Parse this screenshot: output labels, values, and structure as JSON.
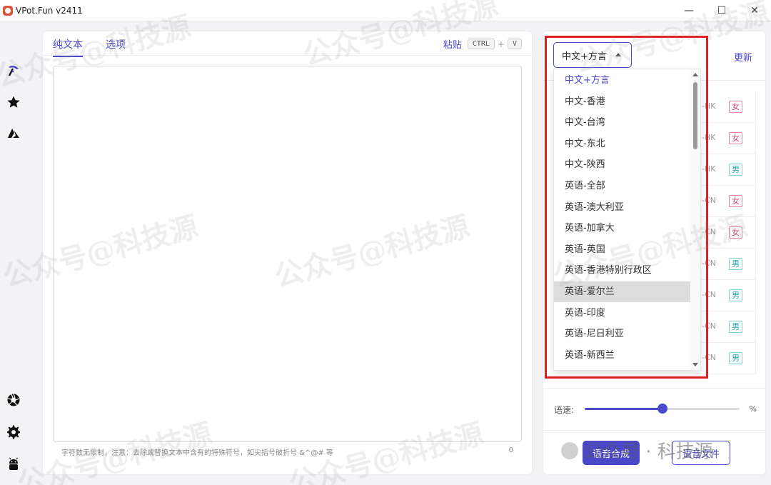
{
  "window": {
    "title": "VPot.Fun v2411",
    "controls": [
      "—",
      "☐",
      "✕"
    ]
  },
  "sidebar": {
    "top_icons": [
      "voice-icon",
      "star-icon",
      "azure-icon"
    ],
    "bottom_icons": [
      "shutter-icon",
      "gear-icon",
      "android-icon"
    ]
  },
  "editor": {
    "tabs": [
      {
        "label": "纯文本",
        "active": true
      },
      {
        "label": "选项",
        "active": false
      }
    ],
    "paste_label": "粘贴",
    "paste_keys": [
      "CTRL",
      "+",
      "V"
    ],
    "text_value": "",
    "hint": "字符数无限制，注意：去除或替换文本中含有的特殊符号，如尖括号破折号 &^@# 等",
    "char_count": "0"
  },
  "voice_panel": {
    "language_selected": "中文+方言",
    "refresh_label": "更新",
    "voices": [
      {
        "locale_suffix": "-HK",
        "gender": "女"
      },
      {
        "locale_suffix": "-HK",
        "gender": "女"
      },
      {
        "locale_suffix": "-HK",
        "gender": "男"
      },
      {
        "locale_suffix": "-CN",
        "gender": "女"
      },
      {
        "locale_suffix": "-CN",
        "gender": "女"
      },
      {
        "locale_suffix": "-CN",
        "gender": "男"
      },
      {
        "locale_suffix": "-CN",
        "gender": "男"
      },
      {
        "locale_suffix": "-CN",
        "gender": "男"
      },
      {
        "locale_suffix": "-CN",
        "gender": "男"
      }
    ],
    "speed_label": "语速:",
    "speed_unit": "%",
    "speed_fraction": 0.5,
    "synthesize_label": "语音合成",
    "document_label": "语音文件"
  },
  "language_dropdown": {
    "options": [
      "中文+方言",
      "中文-香港",
      "中文-台湾",
      "中文-东北",
      "中文-陕西",
      "英语-全部",
      "英语-澳大利亚",
      "英语-加拿大",
      "英语-英国",
      "英语-香港特别行政区",
      "英语-爱尔兰",
      "英语-印度",
      "英语-尼日利亚",
      "英语-新西兰"
    ],
    "selected_index": 0,
    "hovered_index": 10
  },
  "watermark": {
    "text": "公众号@科技源",
    "badge_text": "公众号 · 科技源"
  },
  "colors": {
    "accent": "#4a47c9",
    "highlight": "#e02020",
    "female": "#d34773",
    "male": "#2aa6b8"
  }
}
